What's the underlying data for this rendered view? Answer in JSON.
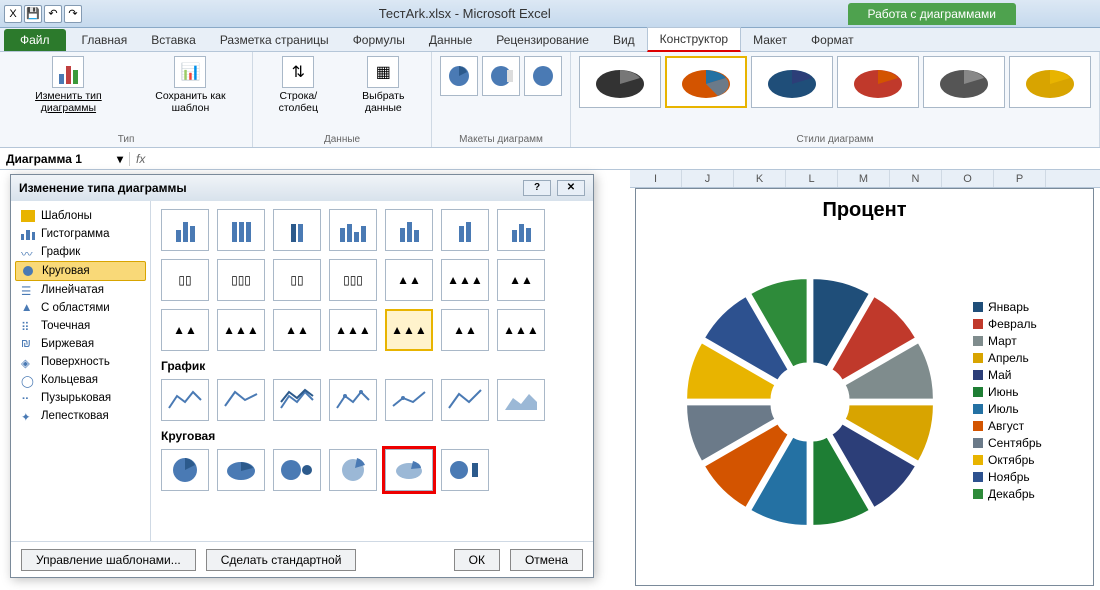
{
  "titlebar": {
    "filename": "ТестArk.xlsx - Microsoft Excel",
    "chart_tools": "Работа с диаграммами"
  },
  "tabs": {
    "file": "Файл",
    "items": [
      "Главная",
      "Вставка",
      "Разметка страницы",
      "Формулы",
      "Данные",
      "Рецензирование",
      "Вид",
      "Конструктор",
      "Макет",
      "Формат"
    ],
    "active": "Конструктор"
  },
  "ribbon": {
    "type_group": {
      "change_type": "Изменить тип диаграммы",
      "save_template": "Сохранить как шаблон",
      "label": "Тип"
    },
    "data_group": {
      "swap": "Строка/столбец",
      "select": "Выбрать данные",
      "label": "Данные"
    },
    "layouts_label": "Макеты диаграмм",
    "styles_label": "Стили диаграмм"
  },
  "formula_bar": {
    "name": "Диаграмма 1",
    "fx": "fx"
  },
  "columns": [
    "I",
    "J",
    "K",
    "L",
    "M",
    "N",
    "O",
    "P"
  ],
  "dialog": {
    "title": "Изменение типа диаграммы",
    "categories": [
      "Шаблоны",
      "Гистограмма",
      "График",
      "Круговая",
      "Линейчатая",
      "С областями",
      "Точечная",
      "Биржевая",
      "Поверхность",
      "Кольцевая",
      "Пузырьковая",
      "Лепестковая"
    ],
    "selected_category": "Круговая",
    "section_line": "График",
    "section_pie": "Круговая",
    "manage_templates": "Управление шаблонами...",
    "make_default": "Сделать стандартной",
    "ok": "ОК",
    "cancel": "Отмена"
  },
  "chart": {
    "title": "Процент",
    "legend": [
      "Январь",
      "Февраль",
      "Март",
      "Апрель",
      "Май",
      "Июнь",
      "Июль",
      "Август",
      "Сентябрь",
      "Октябрь",
      "Ноябрь",
      "Декабрь"
    ],
    "colors": [
      "#1f4e79",
      "#c0392b",
      "#7f8c8d",
      "#d8a400",
      "#2c3e78",
      "#1e7e34",
      "#2471a3",
      "#d35400",
      "#6b7a89",
      "#e8b400",
      "#2d518f",
      "#2e8b3a"
    ]
  },
  "chart_data": {
    "type": "pie",
    "title": "Процент",
    "categories": [
      "Январь",
      "Февраль",
      "Март",
      "Апрель",
      "Май",
      "Июнь",
      "Июль",
      "Август",
      "Сентябрь",
      "Октябрь",
      "Ноябрь",
      "Декабрь"
    ],
    "values": [
      8.33,
      8.33,
      8.33,
      8.33,
      8.33,
      8.33,
      8.33,
      8.33,
      8.33,
      8.33,
      8.33,
      8.33
    ],
    "note": "Exploded 3-D pie with equal slices (approx.)"
  }
}
